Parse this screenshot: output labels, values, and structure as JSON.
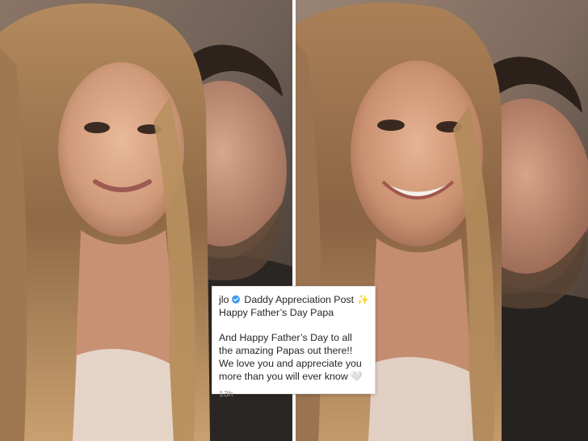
{
  "photos": {
    "left": {
      "description_icon": "selfie-photo"
    },
    "right": {
      "description_icon": "selfie-photo"
    }
  },
  "caption": {
    "username": "jlo",
    "verified_icon": "verified-badge-icon",
    "title": "Daddy Appreciation Post",
    "sparkle": "✨",
    "line2": "Happy Father’s Day Papa",
    "body": "And Happy Father’s Day to all the amazing Papas out there!! We love you and appreciate you more than you will ever know",
    "heart": "🤍",
    "timestamp": "13h"
  },
  "colors": {
    "verified_blue": "#3897f0",
    "text": "#262626",
    "muted": "#8e8e8e"
  }
}
